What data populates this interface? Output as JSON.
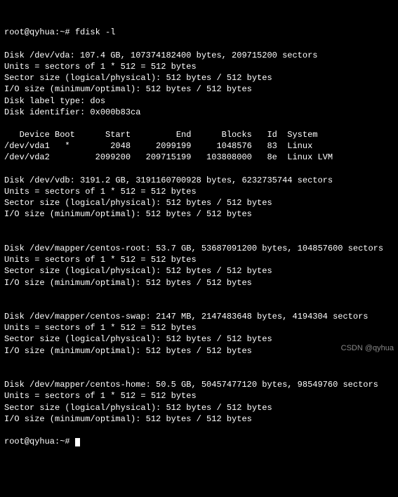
{
  "prompt1": "root@qyhua:~# fdisk -l",
  "disk_vda": {
    "header": "Disk /dev/vda: 107.4 GB, 107374182400 bytes, 209715200 sectors",
    "units": "Units = sectors of 1 * 512 = 512 bytes",
    "sector": "Sector size (logical/physical): 512 bytes / 512 bytes",
    "io": "I/O size (minimum/optimal): 512 bytes / 512 bytes",
    "label": "Disk label type: dos",
    "ident": "Disk identifier: 0x000b83ca"
  },
  "part_header": "   Device Boot      Start         End      Blocks   Id  System",
  "part1": "/dev/vda1   *        2048     2099199     1048576   83  Linux",
  "part2": "/dev/vda2         2099200   209715199   103808000   8e  Linux LVM",
  "disk_vdb": {
    "header": "Disk /dev/vdb: 3191.2 GB, 3191160700928 bytes, 6232735744 sectors",
    "units": "Units = sectors of 1 * 512 = 512 bytes",
    "sector": "Sector size (logical/physical): 512 bytes / 512 bytes",
    "io": "I/O size (minimum/optimal): 512 bytes / 512 bytes"
  },
  "disk_root": {
    "header": "Disk /dev/mapper/centos-root: 53.7 GB, 53687091200 bytes, 104857600 sectors",
    "units": "Units = sectors of 1 * 512 = 512 bytes",
    "sector": "Sector size (logical/physical): 512 bytes / 512 bytes",
    "io": "I/O size (minimum/optimal): 512 bytes / 512 bytes"
  },
  "disk_swap": {
    "header": "Disk /dev/mapper/centos-swap: 2147 MB, 2147483648 bytes, 4194304 sectors",
    "units": "Units = sectors of 1 * 512 = 512 bytes",
    "sector": "Sector size (logical/physical): 512 bytes / 512 bytes",
    "io": "I/O size (minimum/optimal): 512 bytes / 512 bytes"
  },
  "disk_home": {
    "header": "Disk /dev/mapper/centos-home: 50.5 GB, 50457477120 bytes, 98549760 sectors",
    "units": "Units = sectors of 1 * 512 = 512 bytes",
    "sector": "Sector size (logical/physical): 512 bytes / 512 bytes",
    "io": "I/O size (minimum/optimal): 512 bytes / 512 bytes"
  },
  "prompt2": "root@qyhua:~# ",
  "watermark": "CSDN @qyhua"
}
